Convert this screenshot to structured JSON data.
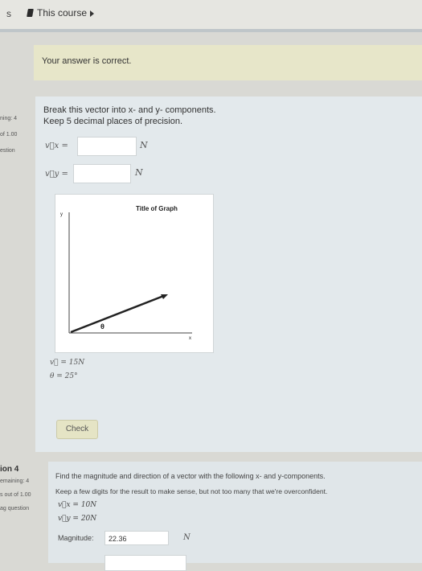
{
  "breadcrumb": {
    "left": "s",
    "course": "This course"
  },
  "feedback": {
    "text": "Your answer is correct."
  },
  "question3": {
    "sidebar": {
      "status": "ning: 4",
      "marks": "of 1.00",
      "flag": "estion"
    },
    "prompt": "Break this vector into x- and y- components.",
    "precision": "Keep 5 decimal places of precision.",
    "vx_label": "v⃗x =",
    "vy_label": "v⃗y =",
    "vx_value": "",
    "vy_value": "",
    "unit": "N",
    "graph": {
      "title": "Title of Graph",
      "y_axis": "y",
      "x_axis": "x",
      "angle_symbol": "θ"
    },
    "given_v": "v⃗ = 15N",
    "given_theta": "θ = 25°",
    "check_label": "Check"
  },
  "question4": {
    "sidebar": {
      "number": "ion 4",
      "status": "emaining: 4",
      "marks": "s out of 1.00",
      "flag": "ag question"
    },
    "prompt": "Find the magnitude and direction of a vector with the following x- and y-components.",
    "hint": "Keep a few digits for the result to make sense, but not too many that we're overconfident.",
    "vx": "v⃗x = 10N",
    "vy": "v⃗y = 20N",
    "magnitude_label": "Magnitude:",
    "magnitude_value": "22.36",
    "unit": "N",
    "direction_value": ""
  }
}
